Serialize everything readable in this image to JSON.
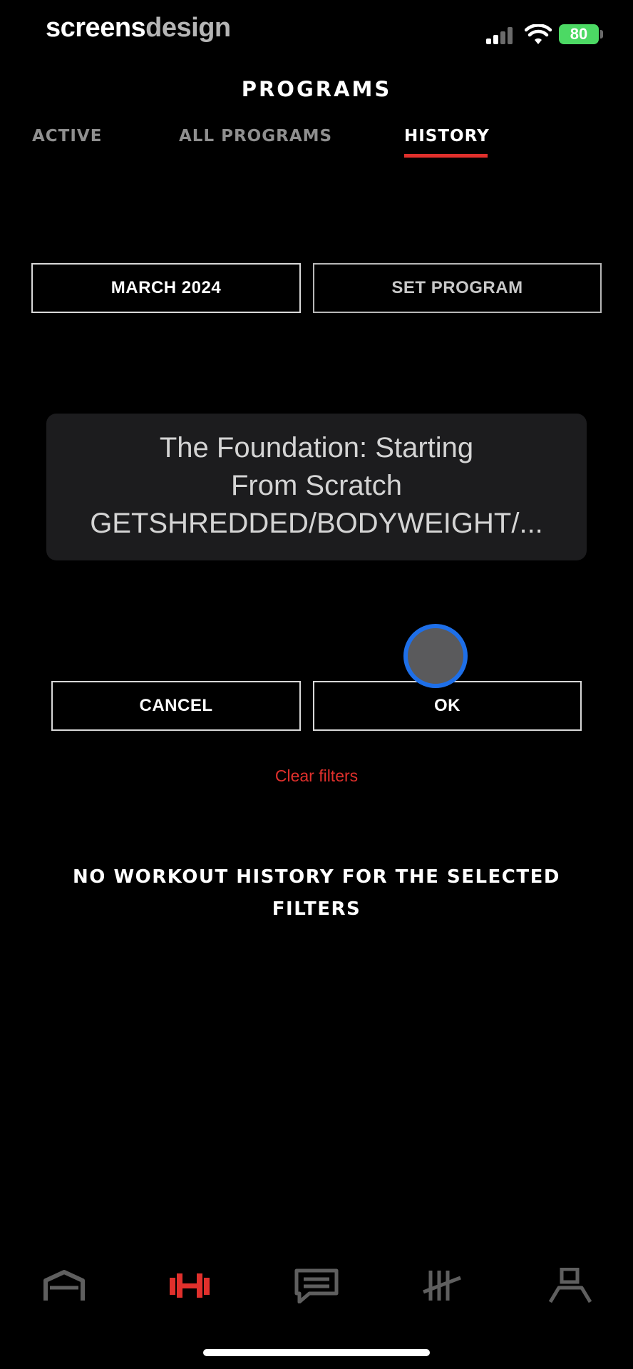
{
  "status_bar": {
    "brand_primary": "screens",
    "brand_secondary": "design",
    "battery": "80"
  },
  "header": {
    "title": "PROGRAMS",
    "tabs": [
      {
        "label": "ACTIVE",
        "active": false
      },
      {
        "label": "ALL PROGRAMS",
        "active": false
      },
      {
        "label": "HISTORY",
        "active": true
      }
    ]
  },
  "filters": {
    "month": "MARCH 2024",
    "program": "SET PROGRAM"
  },
  "picker": {
    "line1": "The Foundation: Starting",
    "line2": "From Scratch",
    "line3": "GETSHREDDED/BODYWEIGHT/..."
  },
  "actions": {
    "cancel": "CANCEL",
    "ok": "OK",
    "clear_filters": "Clear filters"
  },
  "empty_state": {
    "line1": "NO WORKOUT HISTORY FOR THE SELECTED",
    "line2": "FILTERS"
  },
  "bottom_nav": [
    {
      "icon": "home-icon",
      "active": false
    },
    {
      "icon": "dumbbell-icon",
      "active": true
    },
    {
      "icon": "chat-icon",
      "active": false
    },
    {
      "icon": "tally-icon",
      "active": false
    },
    {
      "icon": "profile-icon",
      "active": false
    }
  ],
  "colors": {
    "accent": "#e0302c",
    "background": "#000000",
    "inactive_icon": "#5f5f5f"
  }
}
